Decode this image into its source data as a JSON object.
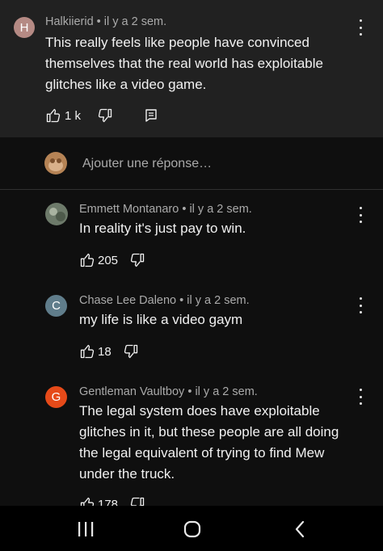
{
  "top_comment": {
    "avatar_letter": "H",
    "avatar_color": "#b58a84",
    "author": "Halkiierid",
    "time": "il y a 2 sem.",
    "text_lines": [
      "This really feels like people have convinced",
      "themselves that the real world has exploitable",
      "glitches like a video game."
    ],
    "like_count": "1 k"
  },
  "reply_input": {
    "placeholder": "Ajouter une réponse…"
  },
  "replies": [
    {
      "author": "Emmett Montanaro",
      "time": "il y a 2 sem.",
      "text_lines": [
        "In reality it's just pay to win."
      ],
      "like_count": "205"
    },
    {
      "avatar_letter": "C",
      "avatar_color": "#607d8b",
      "author": "Chase Lee Daleno",
      "time": "il y a 2 sem.",
      "text_lines": [
        "my life is like a video gaym"
      ],
      "like_count": "18"
    },
    {
      "avatar_letter": "G",
      "avatar_color": "#e64a19",
      "author": "Gentleman Vaultboy",
      "time": "il y a 2 sem.",
      "text_lines": [
        "The legal system does have exploitable",
        "glitches in it, but these people are all doing",
        "the legal equivalent of trying to find Mew",
        "under the truck."
      ],
      "like_count": "178"
    }
  ],
  "separator": " • "
}
